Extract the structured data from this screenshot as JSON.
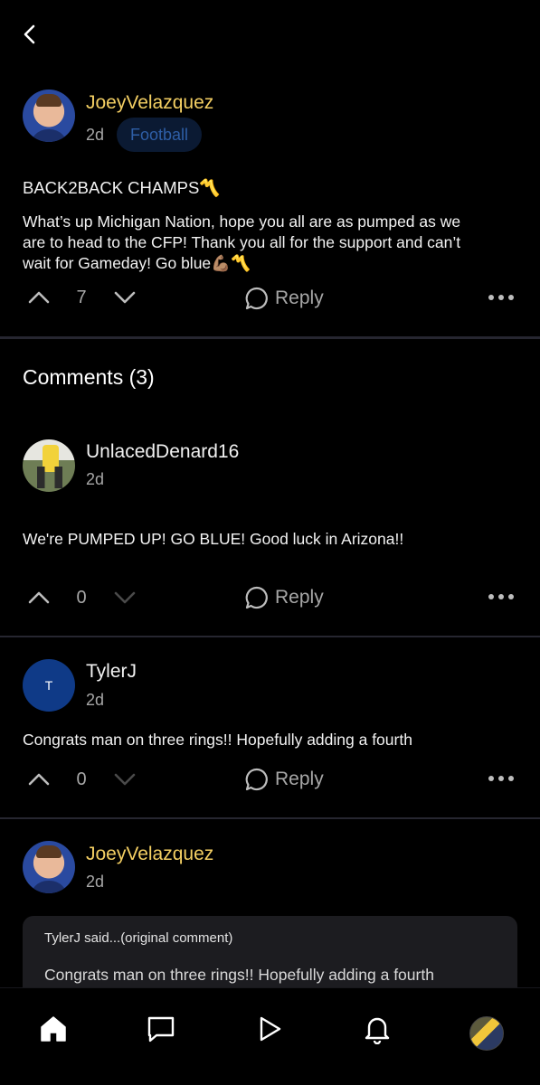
{
  "post": {
    "author": "JoeyVelazquez",
    "time": "2d",
    "tag": "Football",
    "title": "BACK2BACK CHAMPS〽️",
    "body_line1": "What’s up Michigan Nation, hope you all are as pumped as we",
    "body_line2": "are to head to the CFP! Thank you all for the support and can’t",
    "body_line3": "wait for Gameday! Go blue💪🏽〽️",
    "votes": "7",
    "reply_label": "Reply"
  },
  "comments_header": "Comments (3)",
  "comments": [
    {
      "author": "UnlacedDenard16",
      "time": "2d",
      "text": "We're PUMPED UP! GO BLUE! Good luck in Arizona!!",
      "votes": "0",
      "reply_label": "Reply"
    },
    {
      "author": "TylerJ",
      "avatar_letter": "T",
      "time": "2d",
      "text": "Congrats man on three rings!! Hopefully adding a fourth",
      "votes": "0",
      "reply_label": "Reply"
    },
    {
      "author": "JoeyVelazquez",
      "time": "2d",
      "quote_header": "TylerJ said...(original comment)",
      "quote_text": "Congrats man on three rings!! Hopefully adding a fourth"
    }
  ],
  "icons": {
    "back": "chevron-left-icon",
    "upvote": "chevron-up-icon",
    "downvote": "chevron-down-icon",
    "reply": "speech-bubble-icon",
    "more": "ellipsis-icon"
  },
  "tabs": [
    {
      "name": "home",
      "icon": "home-icon"
    },
    {
      "name": "messages",
      "icon": "chat-icon"
    },
    {
      "name": "videos",
      "icon": "play-icon"
    },
    {
      "name": "notifications",
      "icon": "bell-icon"
    },
    {
      "name": "profile",
      "icon": "profile-avatar"
    }
  ],
  "colors": {
    "background": "#000000",
    "author_gold": "#f4cf63",
    "tag_text": "#2e5ea6",
    "tag_bg": "#0b1a33",
    "muted": "#a7a7a7",
    "avatar_blue": "#0f3a87"
  }
}
